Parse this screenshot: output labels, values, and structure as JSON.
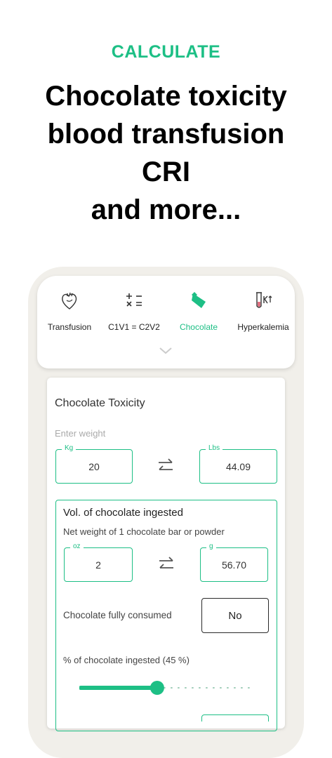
{
  "hero": {
    "kicker": "CALCULATE",
    "lines": [
      "Chocolate toxicity",
      "blood transfusion",
      "CRI",
      "and more..."
    ]
  },
  "tabs": [
    {
      "label": "Transfusion",
      "icon": "heart-icon",
      "active": false
    },
    {
      "label": "C1V1 = C2V2",
      "icon": "math-operators-icon",
      "active": false
    },
    {
      "label": "Chocolate",
      "icon": "chocolate-icon",
      "active": true
    },
    {
      "label": "Hyperkalemia",
      "icon": "test-tube-k-icon",
      "active": false
    }
  ],
  "calculator": {
    "title": "Chocolate Toxicity",
    "weight_hint": "Enter weight",
    "kg": {
      "label": "Kg",
      "value": "20"
    },
    "lbs": {
      "label": "Lbs",
      "value": "44.09"
    },
    "ingested": {
      "title": "Vol. of chocolate ingested",
      "subtitle": "Net weight of 1 chocolate bar or powder",
      "oz": {
        "label": "oz",
        "value": "2"
      },
      "g": {
        "label": "g",
        "value": "56.70"
      },
      "consumed_label": "Chocolate fully consumed",
      "consumed_value": "No",
      "percent_label": "% of chocolate ingested (45 %)",
      "percent": 45
    }
  },
  "colors": {
    "accent": "#1dbf85"
  }
}
